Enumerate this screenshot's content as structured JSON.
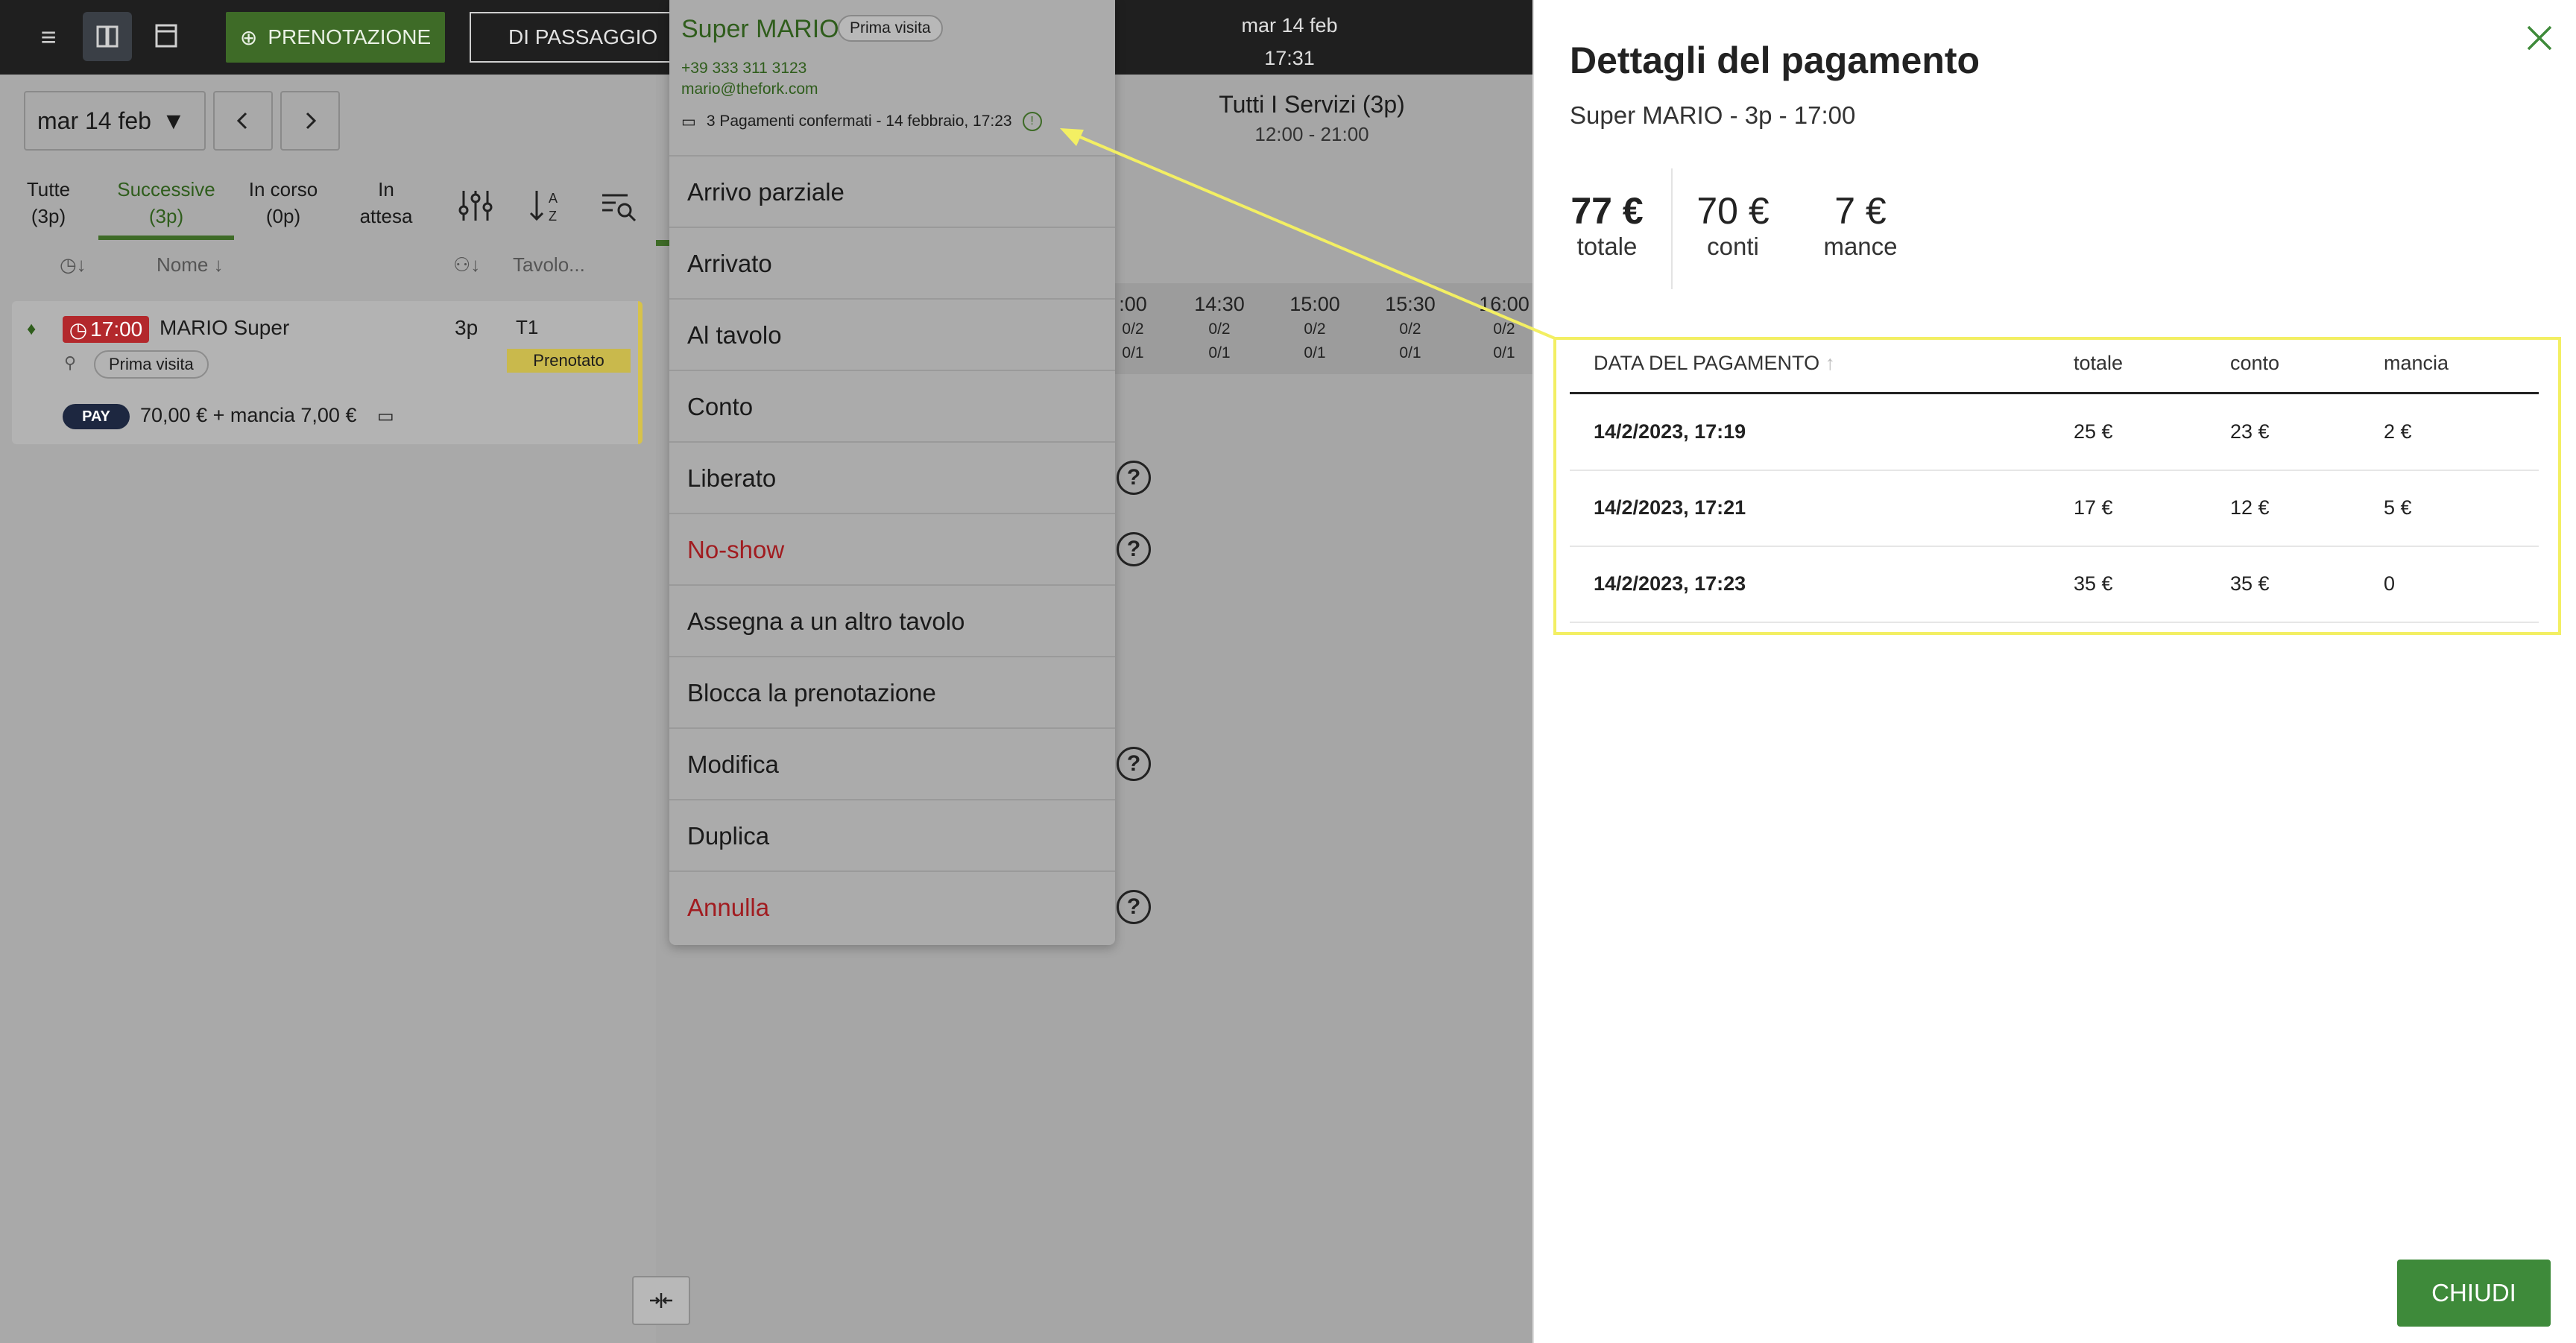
{
  "topbar": {
    "btn_prenotazione": "PRENOTAZIONE",
    "btn_di_passaggio": "DI PASSAGGIO",
    "date": "mar 14 feb",
    "time": "17:31"
  },
  "filters": {
    "date": "mar 14  feb",
    "tabs": [
      {
        "line1": "Tutte",
        "line2": "(3p)"
      },
      {
        "line1": "Successive",
        "line2": "(3p)"
      },
      {
        "line1": "In corso",
        "line2": "(0p)"
      },
      {
        "line1": "In",
        "line2": "attesa"
      }
    ],
    "col_nome": "Nome",
    "col_tavolo": "Tavolo..."
  },
  "reservation": {
    "time": "17:00",
    "name": "MARIO Super",
    "covers": "3p",
    "table": "T1",
    "chip": "Prima visita",
    "status": "Prenotato",
    "pay_badge": "PAY",
    "pay_text": "70,00 € + mancia 7,00 €"
  },
  "service": {
    "title": "Tutti I Servizi  (3p)",
    "hours": "12:00 - 21:00"
  },
  "timeline": [
    {
      "time": ":00",
      "a": "0/2",
      "b": "0/1"
    },
    {
      "time": "14:30",
      "a": "0/2",
      "b": "0/1"
    },
    {
      "time": "15:00",
      "a": "0/2",
      "b": "0/1"
    },
    {
      "time": "15:30",
      "a": "0/2",
      "b": "0/1"
    },
    {
      "time": "16:00",
      "a": "0/2",
      "b": "0/1"
    }
  ],
  "dropdown": {
    "name": "Super MARIO",
    "chip": "Prima visita",
    "phone": "+39 333 311 3123",
    "email": "mario@thefork.com",
    "payments_note": "3 Pagamenti confermati - 14 febbraio, 17:23",
    "items": [
      {
        "label": "Arrivo parziale",
        "red": false,
        "help": false
      },
      {
        "label": "Arrivato",
        "red": false,
        "help": false
      },
      {
        "label": "Al tavolo",
        "red": false,
        "help": false
      },
      {
        "label": "Conto",
        "red": false,
        "help": false
      },
      {
        "label": "Liberato",
        "red": false,
        "help": true
      },
      {
        "label": "No-show",
        "red": true,
        "help": true
      },
      {
        "label": "Assegna a un altro tavolo",
        "red": false,
        "help": false
      },
      {
        "label": "Blocca la prenotazione",
        "red": false,
        "help": false
      },
      {
        "label": "Modifica",
        "red": false,
        "help": true
      },
      {
        "label": "Duplica",
        "red": false,
        "help": false
      },
      {
        "label": "Annulla",
        "red": true,
        "help": true
      }
    ]
  },
  "payment_details": {
    "title": "Dettagli del pagamento",
    "subtitle": "Super MARIO - 3p - 17:00",
    "totale_value": "77 €",
    "totale_label": "totale",
    "conti_value": "70 €",
    "conti_label": "conti",
    "mance_value": "7 €",
    "mance_label": "mance",
    "columns": {
      "date": "DATA DEL PAGAMENTO",
      "totale": "totale",
      "conto": "conto",
      "mancia": "mancia"
    },
    "rows": [
      {
        "date": "14/2/2023, 17:19",
        "totale": "25 €",
        "conto": "23 €",
        "mancia": "2 €"
      },
      {
        "date": "14/2/2023, 17:21",
        "totale": "17 €",
        "conto": "12 €",
        "mancia": "5 €"
      },
      {
        "date": "14/2/2023, 17:23",
        "totale": "35 €",
        "conto": "35 €",
        "mancia": "0"
      }
    ],
    "close_button": "CHIUDI"
  },
  "colors": {
    "accent_green": "#3e8a3a",
    "highlight_yellow": "#f3ef63",
    "alert_red": "#a11c20"
  }
}
